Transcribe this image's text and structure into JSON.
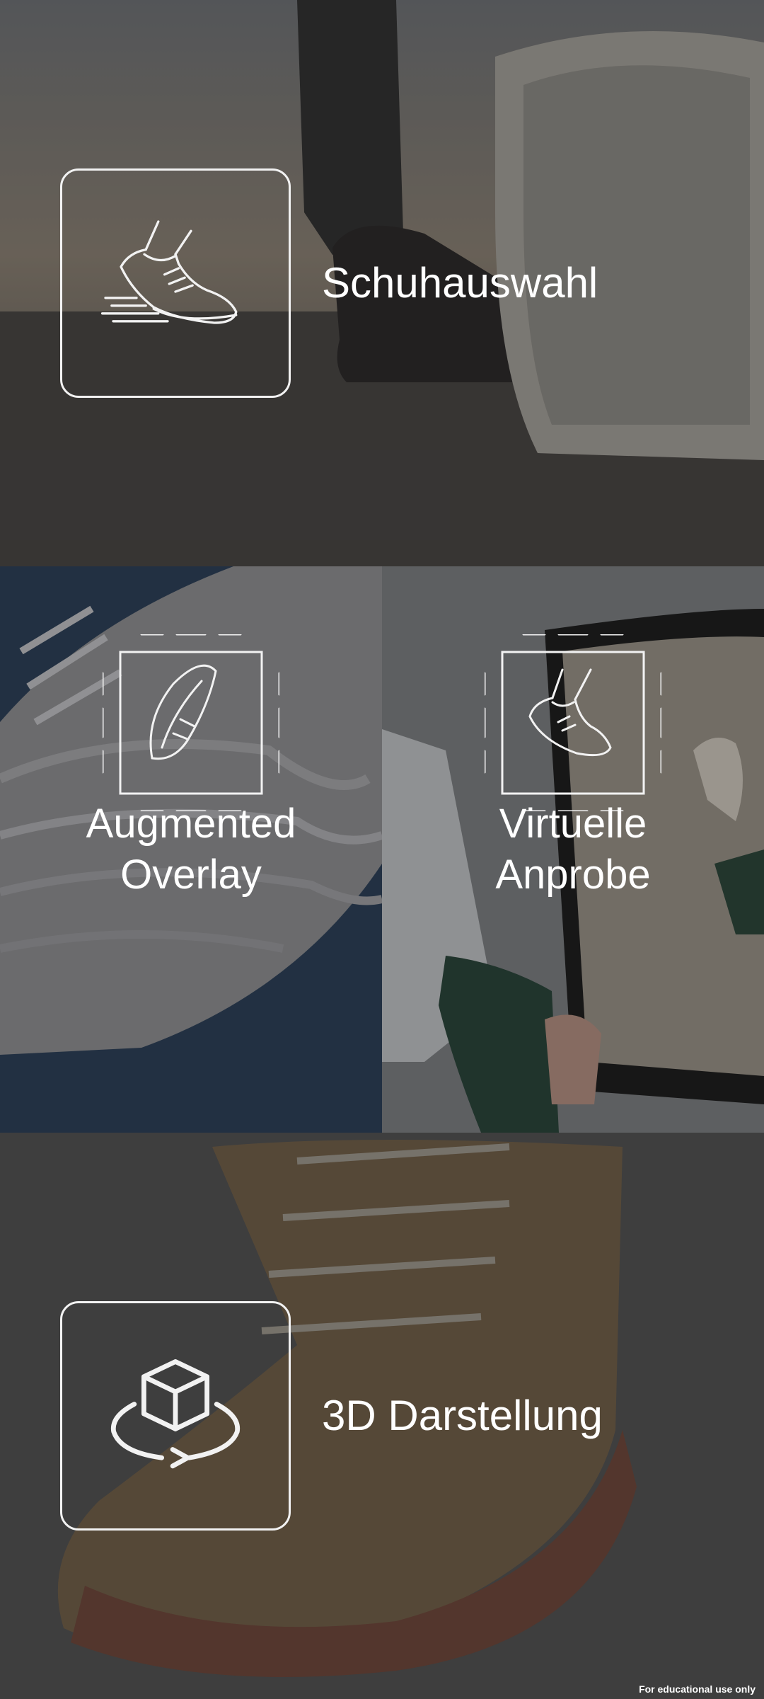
{
  "menu": {
    "items": [
      {
        "id": "shoe-selection",
        "label": "Schuhauswahl",
        "icon": "running-shoe-icon"
      },
      {
        "id": "augmented-overlay",
        "label_line1": "Augmented",
        "label_line2": "Overlay",
        "icon": "shoe-scan-icon"
      },
      {
        "id": "virtual-try-on",
        "label_line1": "Virtuelle",
        "label_line2": "Anprobe",
        "icon": "foot-scan-icon"
      },
      {
        "id": "3d-view",
        "label": "3D Darstellung",
        "icon": "3d-cube-rotate-icon"
      }
    ]
  },
  "footer": {
    "watermark": "For educational use only"
  },
  "colors": {
    "overlay": "#4a4a4a",
    "icon_stroke": "#f2f2f2",
    "text": "#ffffff"
  }
}
